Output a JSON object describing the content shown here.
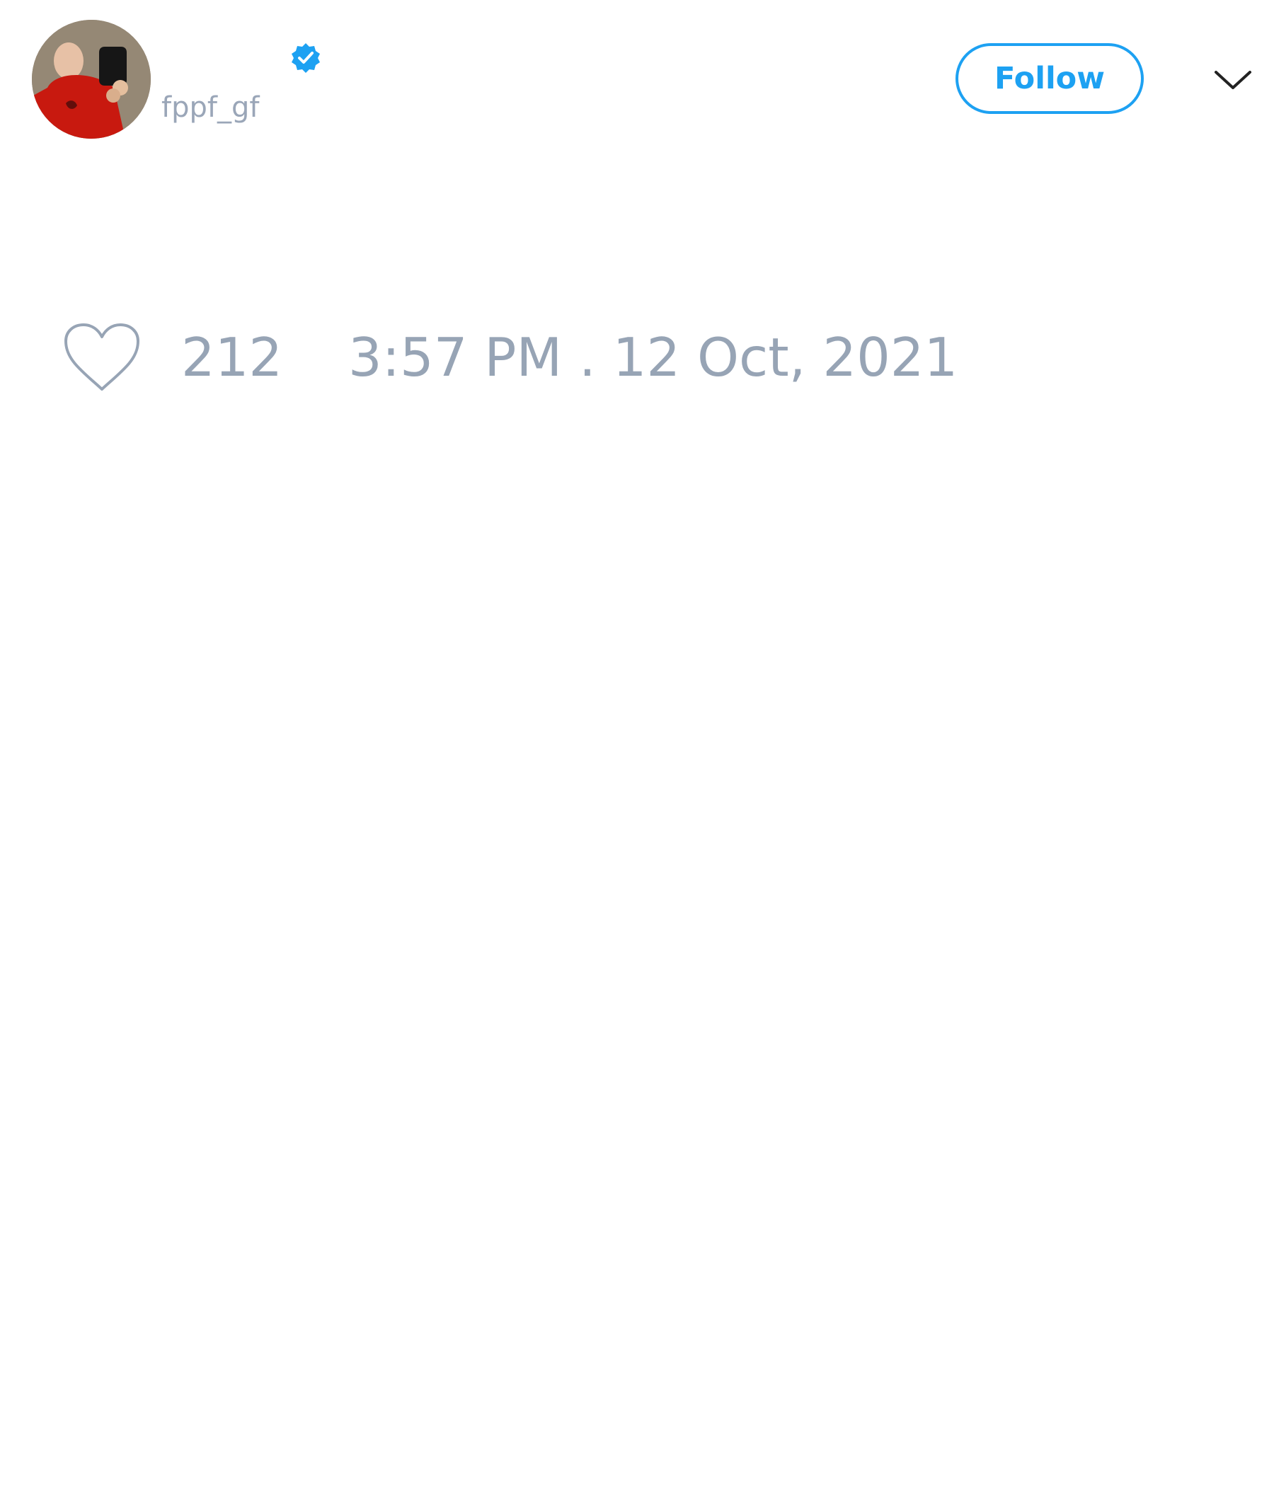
{
  "tweet": {
    "author": {
      "display_name": "",
      "handle": "fppf_gf",
      "avatar_icon": "user-avatar-photo",
      "verified_icon": "verified-badge-icon"
    },
    "actions": {
      "follow_label": "Follow",
      "more_icon": "chevron-down-icon"
    },
    "stats": {
      "like_icon": "heart-outline-icon",
      "like_count": "212",
      "timestamp": "3:57 PM . 12 Oct, 2021"
    }
  },
  "colors": {
    "accent": "#1da1f2",
    "muted_text": "#97a4b5",
    "background": "#ffffff",
    "chevron": "#222222"
  }
}
